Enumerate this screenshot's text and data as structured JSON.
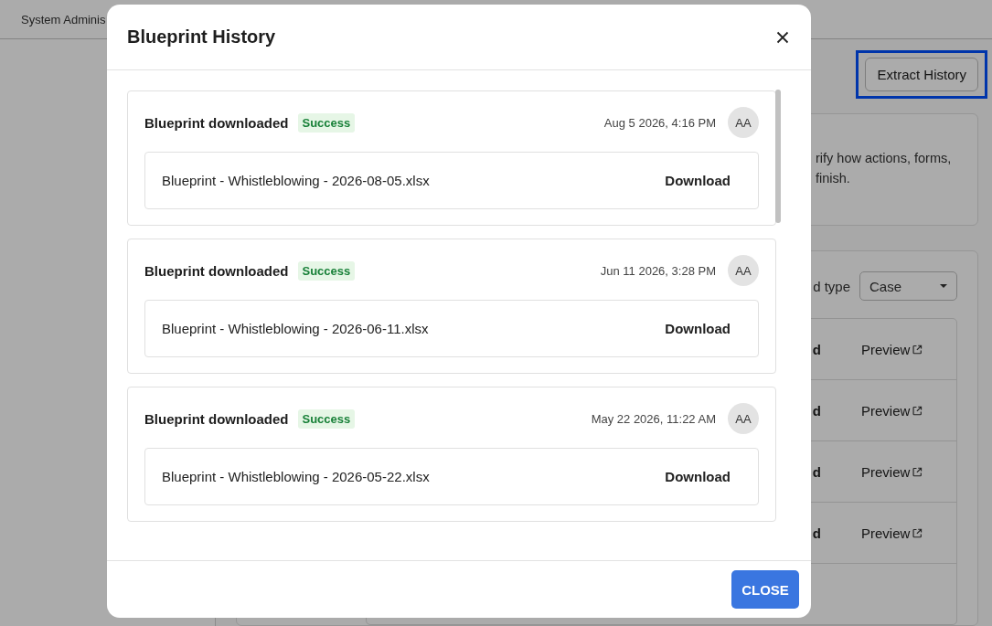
{
  "top_bar": {
    "title": "System Adminis"
  },
  "page": {
    "extract_button": {
      "label": "Extract History",
      "focused": true
    },
    "intro_card": {
      "lines": [
        "rify how actions, forms,",
        "finish."
      ]
    },
    "filter": {
      "label": "d type",
      "value": "Case"
    },
    "table": {
      "rows": [
        {
          "column_1": "d",
          "column_2": "Preview"
        },
        {
          "column_1": "d",
          "column_2": "Preview"
        },
        {
          "column_1": "d",
          "column_2": "Preview"
        },
        {
          "column_1": "d",
          "column_2": "Preview"
        }
      ]
    }
  },
  "modal": {
    "title": "Blueprint History",
    "entries": [
      {
        "title": "Blueprint downloaded",
        "status": "Success",
        "time": "Aug 5 2026, 4:16 PM",
        "avatar": "AA",
        "file": "Blueprint - Whistleblowing - 2026-08-05.xlsx",
        "action": "Download"
      },
      {
        "title": "Blueprint downloaded",
        "status": "Success",
        "time": "Jun 11 2026, 3:28 PM",
        "avatar": "AA",
        "file": "Blueprint - Whistleblowing - 2026-06-11.xlsx",
        "action": "Download"
      },
      {
        "title": "Blueprint downloaded",
        "status": "Success",
        "time": "May 22 2026, 11:22 AM",
        "avatar": "AA",
        "file": "Blueprint - Whistleblowing - 2026-05-22.xlsx",
        "action": "Download"
      }
    ],
    "close_button": "CLOSE"
  }
}
